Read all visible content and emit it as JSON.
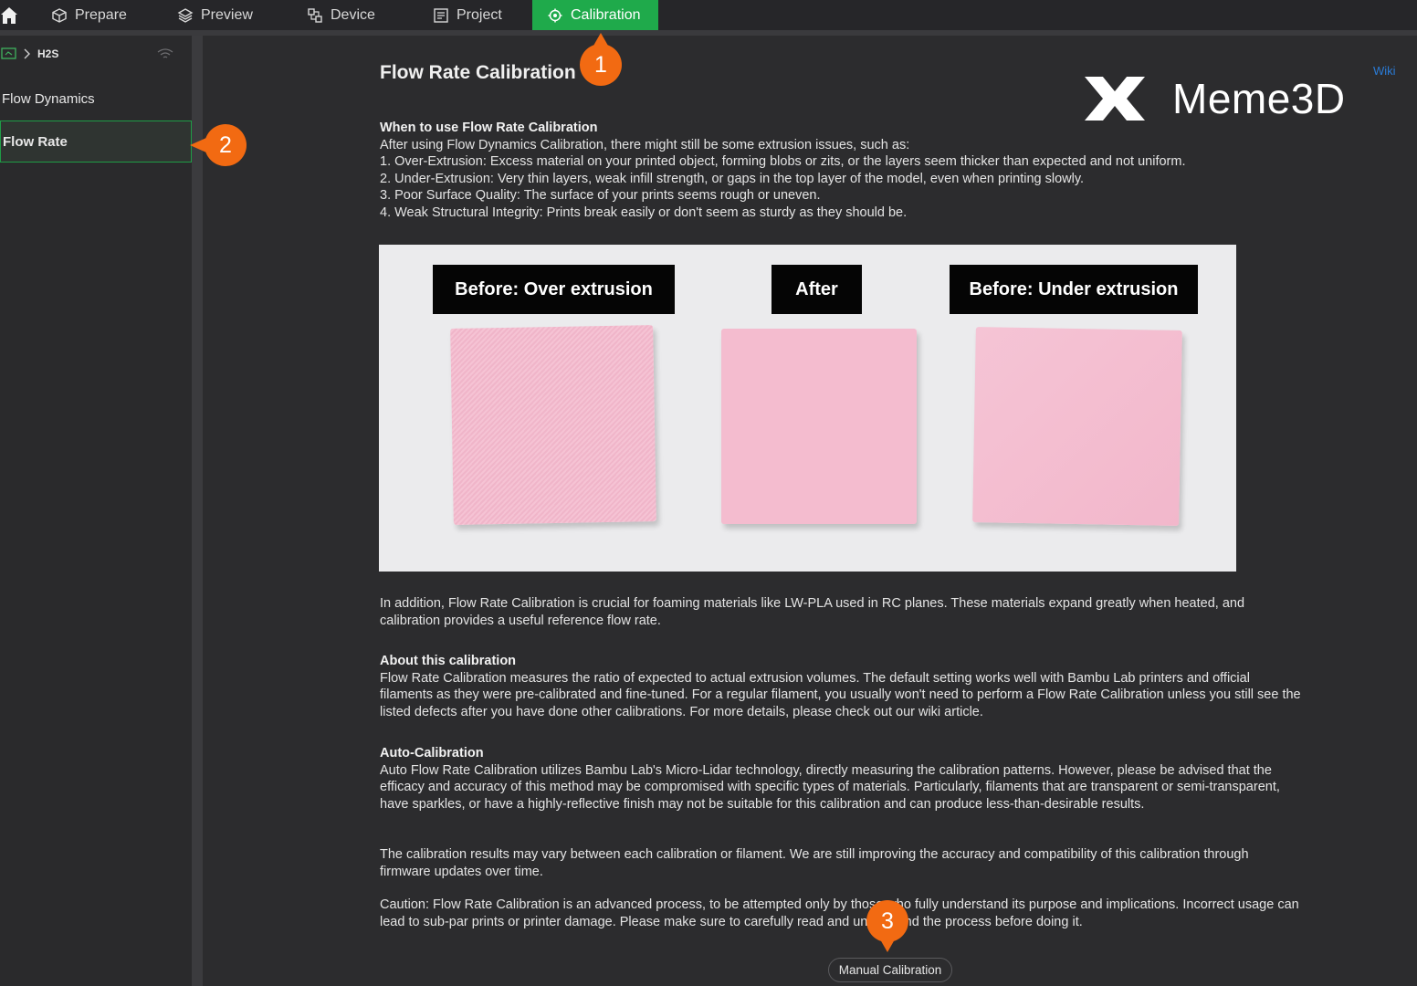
{
  "nav": {
    "tabs": [
      {
        "label": "Prepare",
        "icon": "cube-icon"
      },
      {
        "label": "Preview",
        "icon": "layers-icon"
      },
      {
        "label": "Device",
        "icon": "device-icon"
      },
      {
        "label": "Project",
        "icon": "project-icon"
      },
      {
        "label": "Calibration",
        "icon": "calibration-icon",
        "active": true
      }
    ]
  },
  "sidebar": {
    "printer": "H2S",
    "items": [
      {
        "label": "Flow Dynamics",
        "active": false
      },
      {
        "label": "Flow Rate",
        "active": true
      }
    ]
  },
  "main": {
    "title": "Flow Rate Calibration",
    "wiki": "Wiki",
    "when_heading": "When to use Flow Rate Calibration",
    "when_intro": "After using Flow Dynamics Calibration, there might still be some extrusion issues, such as:",
    "when_items": [
      "1. Over-Extrusion: Excess material on your printed object, forming blobs or zits, or the layers seem thicker than expected and not uniform.",
      "2. Under-Extrusion: Very thin layers, weak infill strength, or gaps in the top layer of the model, even when printing slowly.",
      "3. Poor Surface Quality: The surface of your prints seems rough or uneven.",
      "4. Weak Structural Integrity: Prints break easily or don't seem as sturdy as they should be."
    ],
    "photo_labels": [
      "Before: Over extrusion",
      "After",
      "Before: Under extrusion"
    ],
    "addition": "In addition, Flow Rate Calibration is crucial for foaming materials like LW-PLA used in RC planes. These materials expand greatly when heated, and calibration provides a useful reference flow rate.",
    "about_heading": "About this calibration",
    "about_text": "Flow Rate Calibration measures the ratio of expected to actual extrusion volumes. The default setting works well with Bambu Lab printers and official filaments as they were pre-calibrated and fine-tuned. For a regular filament, you usually won't need to perform a Flow Rate Calibration unless you still see the listed defects after you have done other calibrations. For more details, please check out our wiki article.",
    "auto_heading": "Auto-Calibration",
    "auto_text": "Auto Flow Rate Calibration utilizes Bambu Lab's Micro-Lidar technology, directly measuring the calibration patterns. However, please be advised that the efficacy and accuracy of this method may be compromised with specific types of materials. Particularly, filaments that are transparent or semi-transparent, have sparkles, or have a highly-reflective finish may not be suitable for this calibration and can produce less-than-desirable results.",
    "results_text": "The calibration results may vary between each calibration or filament. We are still improving the accuracy and compatibility of this calibration through firmware updates over time.",
    "caution_text": "Caution: Flow Rate Calibration is an advanced process, to be attempted only by those who fully understand its purpose and implications. Incorrect usage can lead to sub-par prints or printer damage. Please make sure to carefully read and understand the process before doing it.",
    "manual_button": "Manual Calibration"
  },
  "callouts": [
    "1",
    "2",
    "3"
  ],
  "logo": "Meme3D",
  "colors": {
    "accent": "#1faa4b",
    "callout": "#f26a12",
    "swatch": "#f2b8cd"
  }
}
